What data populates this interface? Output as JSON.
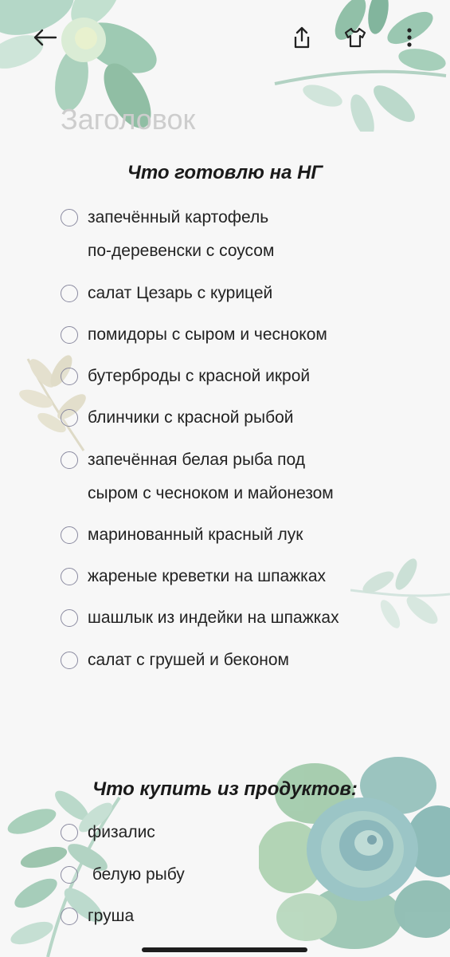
{
  "toolbar": {
    "back_icon": "arrow-left-icon",
    "share_icon": "share-icon",
    "theme_icon": "tshirt-icon",
    "more_icon": "more-vertical-icon"
  },
  "note": {
    "title_placeholder": "Заголовок",
    "title_value": ""
  },
  "sections": [
    {
      "heading": "Что готовлю на НГ",
      "items": [
        {
          "text": "запечённый картофель\nпо-деревенски с соусом",
          "checked": false
        },
        {
          "text": "салат Цезарь с курицей",
          "checked": false
        },
        {
          "text": "помидоры с сыром и чесноком",
          "checked": false
        },
        {
          "text": "бутерброды с красной икрой",
          "checked": false
        },
        {
          "text": "блинчики с красной рыбой",
          "checked": false
        },
        {
          "text": "запечённая белая рыба под\nсыром с чесноком и майонезом",
          "checked": false
        },
        {
          "text": "маринованный красный лук",
          "checked": false
        },
        {
          "text": "жареные креветки на шпажках",
          "checked": false
        },
        {
          "text": "шашлык из индейки на шпажках",
          "checked": false
        },
        {
          "text": "салат с грушей и беконом",
          "checked": false
        }
      ]
    },
    {
      "heading": "Что купить из продуктов:",
      "items": [
        {
          "text": "физалис",
          "checked": false
        },
        {
          "text": " белую рыбу",
          "checked": false
        },
        {
          "text": "груша",
          "checked": false
        }
      ]
    }
  ],
  "colors": {
    "background": "#f7f7f7",
    "text": "#222222",
    "checkbox_border": "#8a8aa0",
    "placeholder": "#cdcdcd",
    "leaf_green": "#7fb596",
    "leaf_blue": "#8fb9c2",
    "leaf_beige": "#d8d2b4"
  }
}
